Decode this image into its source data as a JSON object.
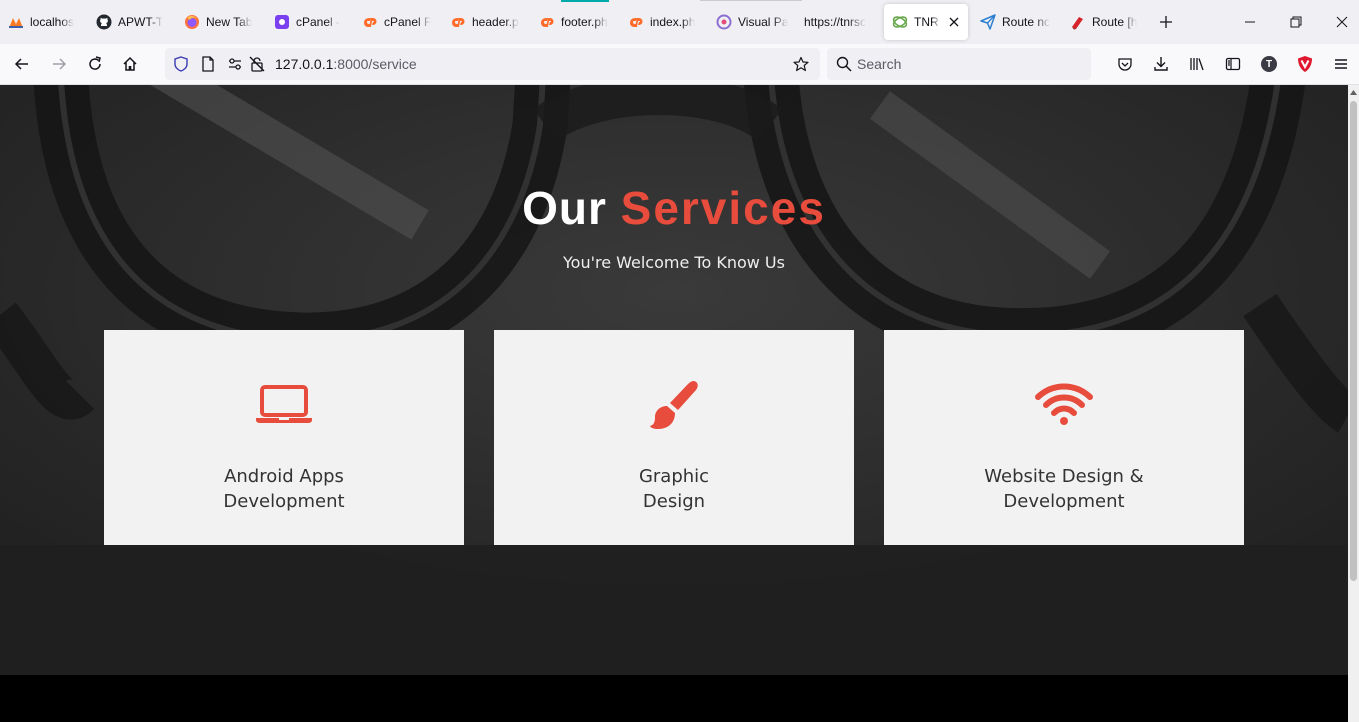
{
  "browser": {
    "tabs": [
      {
        "label": "localhos",
        "icon": "xampp-icon"
      },
      {
        "label": "APWT-T",
        "icon": "github-icon"
      },
      {
        "label": "New Tab",
        "icon": "firefox-icon"
      },
      {
        "label": "cPanel -",
        "icon": "cpanel-purple-icon"
      },
      {
        "label": "cPanel F",
        "icon": "cpanel-icon"
      },
      {
        "label": "header.p",
        "icon": "cpanel-icon"
      },
      {
        "label": "footer.ph",
        "icon": "cpanel-icon"
      },
      {
        "label": "index.ph",
        "icon": "cpanel-icon"
      },
      {
        "label": "Visual Pa",
        "icon": "visual-paradigm-icon"
      },
      {
        "label": "https://tnrsc",
        "icon": ""
      },
      {
        "label": "TNRSC",
        "icon": "tnrsc-icon",
        "active": true
      },
      {
        "label": "Route nc",
        "icon": "paper-plane-icon"
      },
      {
        "label": "Route [h",
        "icon": "laravel-icon"
      }
    ],
    "url": {
      "host": "127.0.0.1",
      "path": ":8000/service"
    },
    "search_placeholder": "Search",
    "account_initial": "T"
  },
  "page": {
    "title_part1": "Our",
    "title_part2": "Services",
    "subtitle": "You're Welcome To Know Us",
    "accent_color": "#e74c3c",
    "services": [
      {
        "icon": "laptop-icon",
        "line1": "Android Apps",
        "line2": "Development"
      },
      {
        "icon": "paint-brush-icon",
        "line1": "Graphic",
        "line2": "Design"
      },
      {
        "icon": "wifi-icon",
        "line1": "Website Design &",
        "line2": "Development"
      }
    ]
  }
}
